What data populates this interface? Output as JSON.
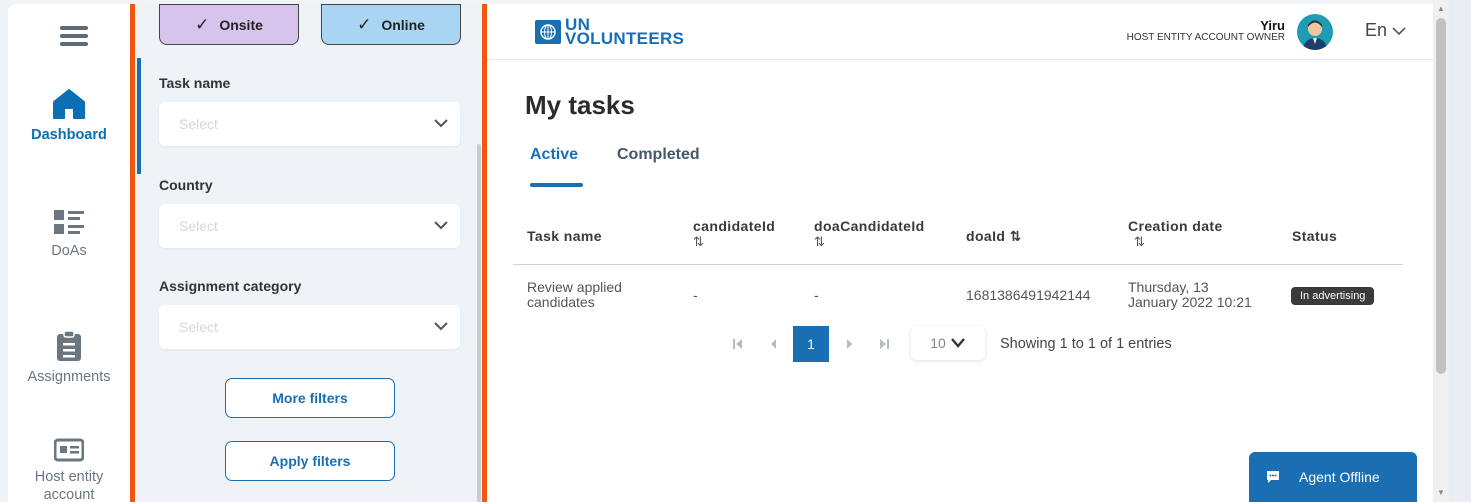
{
  "nav": {
    "items": [
      {
        "label": "Dashboard",
        "icon": "home-icon",
        "active": true
      },
      {
        "label": "DoAs",
        "icon": "list-icon",
        "active": false
      },
      {
        "label": "Assignments",
        "icon": "clipboard-icon",
        "active": false
      },
      {
        "label": "Host entity account",
        "icon": "id-card-icon",
        "active": false
      }
    ]
  },
  "filters": {
    "toggles": [
      {
        "label": "Onsite",
        "checked": true
      },
      {
        "label": "Online",
        "checked": true
      }
    ],
    "fields": [
      {
        "label": "Task name",
        "placeholder": "Select"
      },
      {
        "label": "Country",
        "placeholder": "Select"
      },
      {
        "label": "Assignment category",
        "placeholder": "Select"
      }
    ],
    "more_label": "More filters",
    "apply_label": "Apply filters"
  },
  "header": {
    "logo_line1": "UN",
    "logo_line2": "VOLUNTEERS",
    "user_name": "Yiru",
    "user_role": "HOST ENTITY ACCOUNT OWNER",
    "language": "En"
  },
  "page": {
    "title": "My tasks",
    "tabs": [
      "Active",
      "Completed"
    ]
  },
  "table": {
    "columns": [
      {
        "line1": "Task name",
        "line2": "",
        "sort": false
      },
      {
        "line1": "candidateId",
        "line2": "⇅",
        "sort": true
      },
      {
        "line1": "doaCandidateId",
        "line2": "⇅",
        "sort": true
      },
      {
        "line1": "doaId ⇅",
        "line2": "",
        "sort": true
      },
      {
        "line1": "Creation date",
        "line2": "⇅",
        "sort": true
      },
      {
        "line1": "Status",
        "line2": "",
        "sort": false
      }
    ],
    "rows": [
      {
        "task_line1": "Review applied",
        "task_line2": "candidates",
        "candidate_id": "-",
        "doa_candidate_id": "-",
        "doa_id": "1681386491942144",
        "date_line1": "Thursday, 13",
        "date_line2": "January 2022 10:21",
        "status": "In advertising"
      }
    ]
  },
  "pagination": {
    "current_page": "1",
    "page_size": "10",
    "info": "Showing 1 to 1 of 1 entries"
  },
  "chat": {
    "label": "Agent Offline"
  },
  "colors": {
    "accent": "#1a6fb3",
    "divider_orange": "#f2570f",
    "onsite_pill": "#d6c4ec",
    "online_pill": "#a9d5f3"
  }
}
